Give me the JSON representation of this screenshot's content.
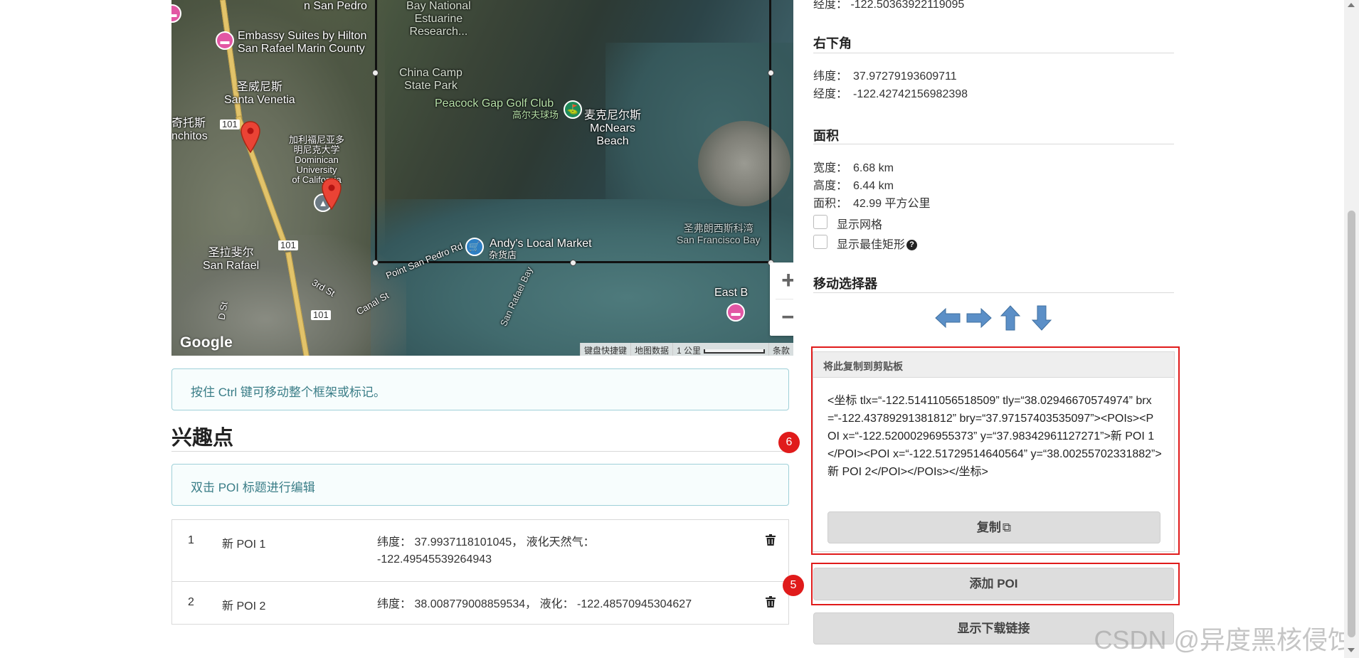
{
  "map": {
    "labels": {
      "embassy": "Embassy Suites by Hilton\nSan Rafael Marin County",
      "bay_national": "Bay National\nEstuarine\nResearch...",
      "china_camp": "China Camp\nState Park",
      "santa_venetia": "圣威尼斯\nSanta Venetia",
      "anchitos": "奇托斯\nnchitos",
      "peacock_gap": "Peacock Gap Golf Club",
      "peacock_gap_zh": "高尔夫球场",
      "mcnears": "麦克尼尔斯\nMcNears\nBeach",
      "dominican": "加利福尼亚多\n明尼克大学\nDominican\nUniversity\nof California",
      "andys": "Andy's Local Market",
      "andys_zh": "杂货店",
      "sf_bay": "圣弗朗西斯科湾\nSan Francisco Bay",
      "san_rafael": "圣拉斐尔\nSan Rafael",
      "san_rafael_bay": "San Rafael Bay",
      "point_san_pedro": "Point San Pedro Rd",
      "san_pedro_top": "n San Pedro",
      "third_st": "3rd St",
      "canal_st": "Canal St",
      "d_st": "D St",
      "east_b": "East B",
      "hwy_101": "101"
    },
    "google_logo": "Google",
    "attribution": {
      "keyboard": "键盘快捷键",
      "map_data": "地图数据",
      "scale": "1 公里",
      "terms": "条款"
    },
    "zoom_in": "+",
    "zoom_out": "−"
  },
  "hints": {
    "ctrl_move": "按住 Ctrl 键可移动整个框架或标记。",
    "dblclick_edit": "双击 POI 标题进行编辑"
  },
  "poi_section": {
    "title": "兴趣点",
    "rows": [
      {
        "num": "1",
        "name": "新 POI 1",
        "coords": "纬度：  37.9937118101045，  液化天然气：\n-122.49545539264943"
      },
      {
        "num": "2",
        "name": "新 POI 2",
        "coords": "纬度：  38.008779008859534，  液化：  -122.48570945304627"
      }
    ]
  },
  "right_panel": {
    "top_partial": "经度：  -122.50363922119095",
    "bottom_right": {
      "heading": "右下角",
      "lat_label": "纬度：",
      "lat": "37.97279193609711",
      "lng_label": "经度：",
      "lng": "-122.42742156982398"
    },
    "area": {
      "heading": "面积",
      "width_label": "宽度：",
      "width": "6.68 km",
      "height_label": "高度：",
      "height": "6.44 km",
      "area_label": "面积：",
      "area": "42.99 平方公里"
    },
    "show_grid": "显示网格",
    "show_best_rect": "显示最佳矩形",
    "move_selector": "移动选择器",
    "clipboard": {
      "header": "将此复制到剪贴板",
      "text": "<坐标 tlx=“-122.51411056518509” tly=“38.02946670574974” brx=“-122.43789291381812” bry=“37.97157403535097”><POIs><POI x=“-122.52000296955373” y=“37.98342961127271”>新 POI 1</POI><POI x=“-122.51729514640564” y=“38.00255702331882”>新 POI 2</POI></POIs></坐标>",
      "copy_button": "复制"
    },
    "add_poi_button": "添加 POI",
    "download_button": "显示下载链接"
  },
  "annotations": {
    "badge_6": "6",
    "badge_5": "5"
  },
  "watermark": "CSDN @异度黑核侵蚀",
  "colors": {
    "annotation_red": "#e01b1b",
    "hint_text": "#3a7d87",
    "button_bg": "#dddddd",
    "arrow_blue": "#5b8fc7"
  }
}
